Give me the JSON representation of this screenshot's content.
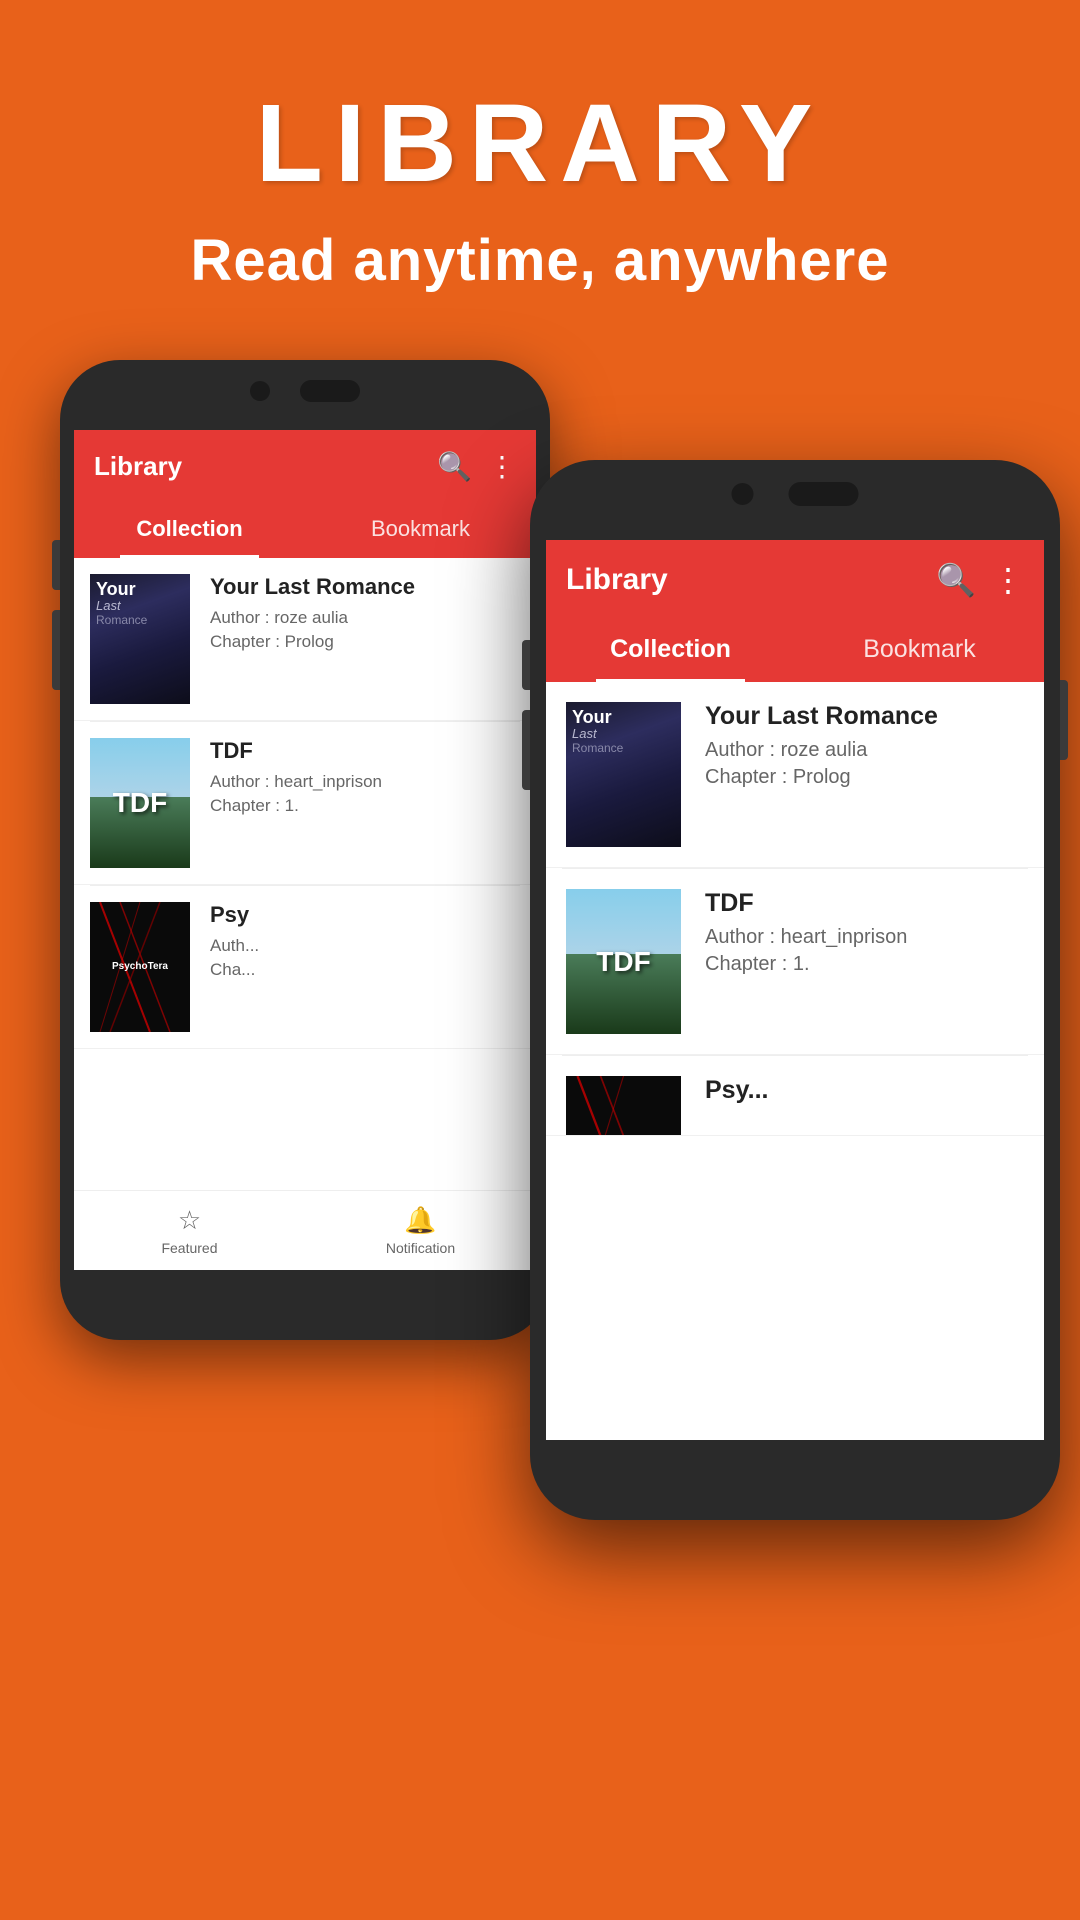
{
  "hero": {
    "title": "LIBRARY",
    "subtitle": "Read anytime, anywhere"
  },
  "phone_back": {
    "app_bar": {
      "title": "Library",
      "search_icon": "🔍",
      "more_icon": "⋮"
    },
    "tabs": [
      {
        "label": "Collection",
        "active": true
      },
      {
        "label": "Bookmark",
        "active": false
      }
    ],
    "books": [
      {
        "title": "Your Last Romance",
        "author": "Author : roze aulia",
        "chapter": "Chapter : Prolog",
        "cover_type": "your-last"
      },
      {
        "title": "TDF",
        "author": "Author : heart_inprison",
        "chapter": "Chapter : 1.",
        "cover_type": "tdf"
      },
      {
        "title": "Psy...",
        "author": "Auth...",
        "chapter": "Cha...",
        "cover_type": "psycho"
      }
    ],
    "bottom_nav": [
      {
        "label": "Featured",
        "icon": "☆"
      },
      {
        "label": "Notification",
        "icon": "🔔"
      }
    ]
  },
  "phone_front": {
    "app_bar": {
      "title": "Library",
      "search_icon": "🔍",
      "more_icon": "⋮"
    },
    "tabs": [
      {
        "label": "Collection",
        "active": true
      },
      {
        "label": "Bookmark",
        "active": false
      }
    ],
    "books": [
      {
        "title": "Your Last Romance",
        "author": "Author : roze aulia",
        "chapter": "Chapter : Prolog",
        "cover_type": "your-last"
      },
      {
        "title": "TDF",
        "author": "Author : heart_inprison",
        "chapter": "Chapter : 1.",
        "cover_type": "tdf"
      }
    ]
  },
  "colors": {
    "primary": "#E53935",
    "background": "#E8611A",
    "text_dark": "#222222",
    "text_light": "#666666"
  }
}
